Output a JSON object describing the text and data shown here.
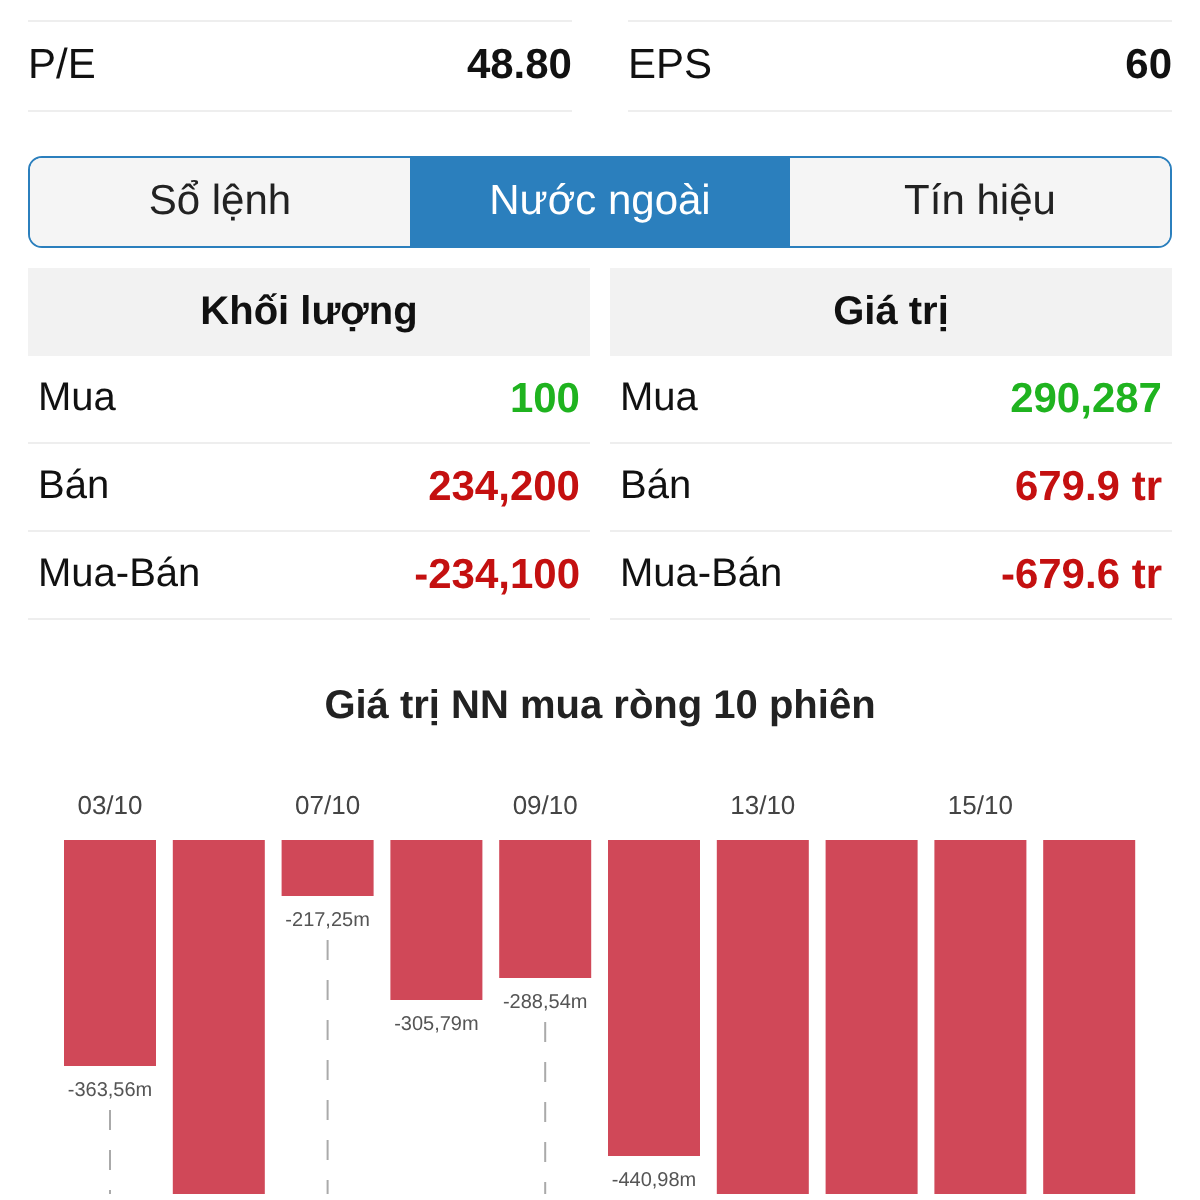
{
  "ratios": [
    {
      "label": "P/E",
      "value": "48.80"
    },
    {
      "label": "EPS",
      "value": "60"
    }
  ],
  "tabs": [
    {
      "label": "Sổ lệnh",
      "selected": false
    },
    {
      "label": "Nước ngoài",
      "selected": true
    },
    {
      "label": "Tín hiệu",
      "selected": false
    }
  ],
  "foreign_tables": [
    {
      "heading": "Khối lượng",
      "rows": [
        {
          "label": "Mua",
          "value": "100",
          "color": "#1fb31f"
        },
        {
          "label": "Bán",
          "value": "234,200",
          "color": "#c41010"
        },
        {
          "label": "Mua-Bán",
          "value": "-234,100",
          "color": "#c41010"
        }
      ]
    },
    {
      "heading": "Giá trị",
      "rows": [
        {
          "label": "Mua",
          "value": "290,287",
          "color": "#1fb31f"
        },
        {
          "label": "Bán",
          "value": "679.9 tr",
          "color": "#c41010"
        },
        {
          "label": "Mua-Bán",
          "value": "-679.6 tr",
          "color": "#c41010"
        }
      ]
    }
  ],
  "chart": {
    "title": "Giá trị NN mua ròng 10 phiên",
    "bars": [
      {
        "kind": "short",
        "date": "03/10",
        "value_label": "-363,56m"
      },
      {
        "kind": "cut"
      },
      {
        "kind": "short",
        "date": "07/10",
        "value_label": "-217,25m"
      },
      {
        "kind": "short",
        "value_label": "-305,79m"
      },
      {
        "kind": "short",
        "date": "09/10",
        "value_label": "-288,54m"
      },
      {
        "kind": "short",
        "value_label": "-440,98m"
      },
      {
        "kind": "cut",
        "date": "13/10"
      },
      {
        "kind": "cut"
      },
      {
        "kind": "cut",
        "date": "15/10"
      },
      {
        "kind": "cut"
      }
    ]
  }
}
